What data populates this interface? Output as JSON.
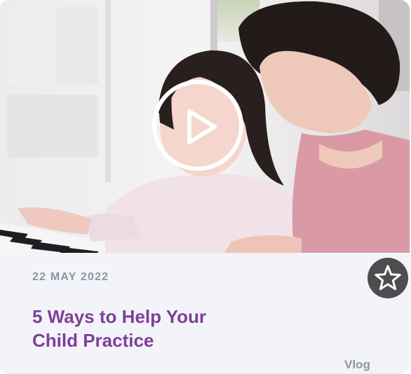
{
  "post": {
    "date": "22 MAY 2022",
    "title_line1": "5 Ways to Help Your",
    "title_line2": "Child Practice",
    "category": "Vlog"
  },
  "icons": {
    "play": "play-icon",
    "favorite": "star-icon"
  },
  "colors": {
    "title": "#7f3f97",
    "date": "#8e93a3",
    "card_background": "#f3f4f9",
    "favorite_button": "#4d4d4f"
  }
}
